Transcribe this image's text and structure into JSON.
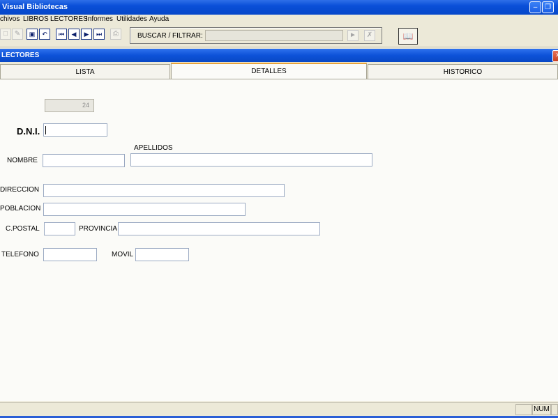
{
  "window": {
    "title": "Visual Bibliotecas"
  },
  "menu": [
    "chivos",
    "LIBROS",
    "LECTORES",
    "Informes",
    "Utilidades",
    "Ayuda"
  ],
  "toolbar": {
    "search_label": "BUSCAR / FILTRAR:",
    "search_value": ""
  },
  "child_window": {
    "title": "LECTORES"
  },
  "tabs": [
    {
      "label": "LISTA",
      "active": false
    },
    {
      "label": "DETALLES",
      "active": true
    },
    {
      "label": "HISTORICO",
      "active": false
    }
  ],
  "form": {
    "id_value": "24",
    "dni_label": "D.N.I.",
    "dni_value": "",
    "nombre_label": "NOMBRE",
    "nombre_value": "",
    "apellidos_label": "APELLIDOS",
    "apellidos_value": "",
    "direccion_label": "DIRECCION",
    "direccion_value": "",
    "poblacion_label": "POBLACION",
    "poblacion_value": "",
    "cpostal_label": "C.POSTAL",
    "cpostal_value": "",
    "provincia_label": "PROVINCIA",
    "provincia_value": "",
    "telefono_label": "TELEFONO",
    "telefono_value": "",
    "movil_label": "MOVIL",
    "movil_value": ""
  },
  "status": {
    "num": "NUM"
  },
  "colors": {
    "title_bar": "#0a4fd8",
    "active_tab_accent": "#e8a33a"
  }
}
